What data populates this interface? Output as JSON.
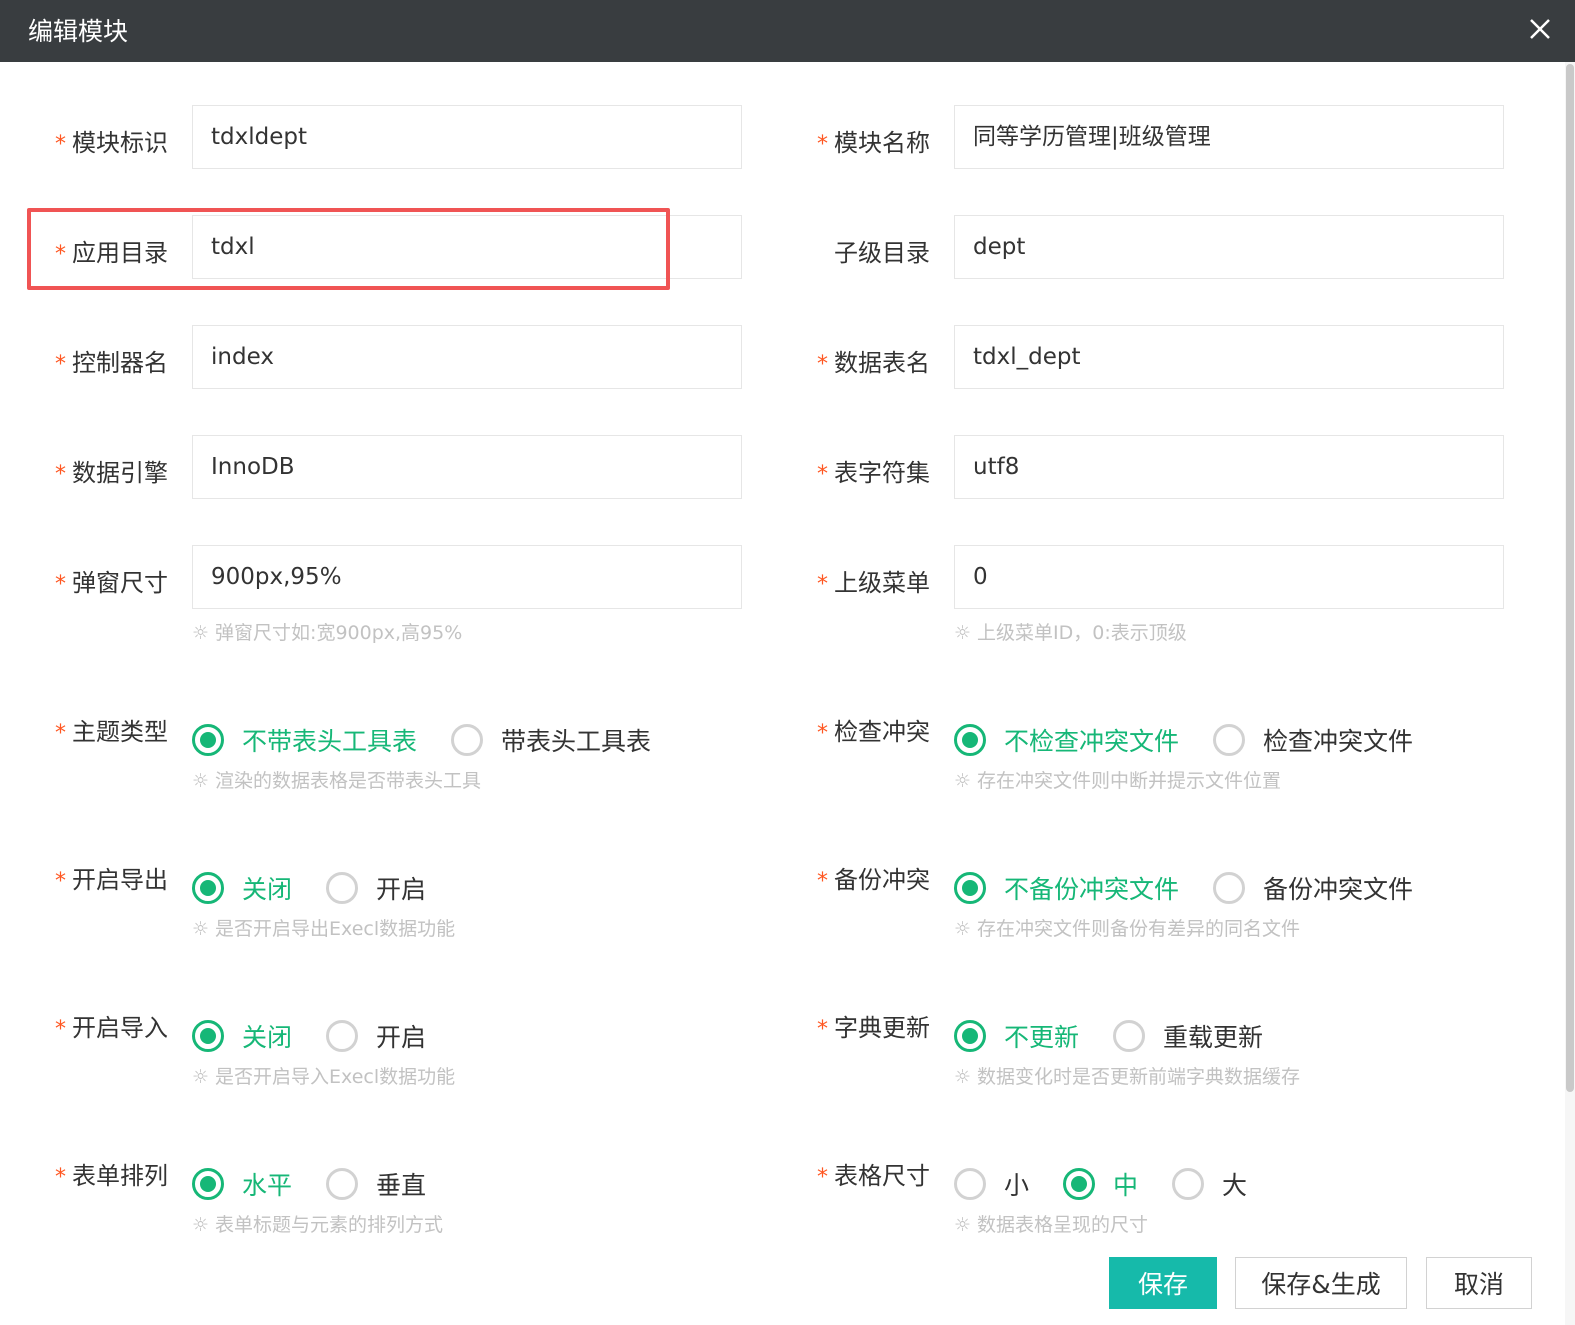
{
  "dialog": {
    "title": "编辑模块",
    "close_icon": "close-icon"
  },
  "fields": {
    "module_id": {
      "label": "模块标识",
      "value": "tdxldept",
      "required": true
    },
    "module_name": {
      "label": "模块名称",
      "value": "同等学历管理|班级管理",
      "required": true
    },
    "app_dir": {
      "label": "应用目录",
      "value": "tdxl",
      "required": true
    },
    "sub_dir": {
      "label": "子级目录",
      "value": "dept",
      "required": false
    },
    "controller": {
      "label": "控制器名",
      "value": "index",
      "required": true
    },
    "table_name": {
      "label": "数据表名",
      "value": "tdxl_dept",
      "required": true
    },
    "engine": {
      "label": "数据引擎",
      "value": "InnoDB",
      "required": true
    },
    "charset": {
      "label": "表字符集",
      "value": "utf8",
      "required": true
    },
    "popup_size": {
      "label": "弹窗尺寸",
      "value": "900px,95%",
      "required": true,
      "hint": "弹窗尺寸如:宽900px,高95%"
    },
    "parent_menu": {
      "label": "上级菜单",
      "value": "0",
      "required": true,
      "hint": "上级菜单ID，0:表示顶级"
    }
  },
  "radios": {
    "theme": {
      "label": "主题类型",
      "options": [
        "不带表头工具表",
        "带表头工具表"
      ],
      "selected": 0,
      "hint": "渲染的数据表格是否带表头工具"
    },
    "check_conflict": {
      "label": "检查冲突",
      "options": [
        "不检查冲突文件",
        "检查冲突文件"
      ],
      "selected": 0,
      "hint": "存在冲突文件则中断并提示文件位置"
    },
    "export": {
      "label": "开启导出",
      "options": [
        "关闭",
        "开启"
      ],
      "selected": 0,
      "hint": "是否开启导出Execl数据功能"
    },
    "backup_conflict": {
      "label": "备份冲突",
      "options": [
        "不备份冲突文件",
        "备份冲突文件"
      ],
      "selected": 0,
      "hint": "存在冲突文件则备份有差异的同名文件"
    },
    "import": {
      "label": "开启导入",
      "options": [
        "关闭",
        "开启"
      ],
      "selected": 0,
      "hint": "是否开启导入Execl数据功能"
    },
    "dict_update": {
      "label": "字典更新",
      "options": [
        "不更新",
        "重载更新"
      ],
      "selected": 0,
      "hint": "数据变化时是否更新前端字典数据缓存"
    },
    "form_layout": {
      "label": "表单排列",
      "options": [
        "水平",
        "垂直"
      ],
      "selected": 0,
      "hint": "表单标题与元素的排列方式"
    },
    "table_size": {
      "label": "表格尺寸",
      "options": [
        "小",
        "中",
        "大"
      ],
      "selected": 1,
      "hint": "数据表格呈现的尺寸"
    }
  },
  "buttons": {
    "save": "保存",
    "save_generate": "保存&生成",
    "cancel": "取消"
  },
  "required_mark": "*",
  "hint_icon": "sun-icon",
  "colors": {
    "accent": "#16b777",
    "primary_button": "#16baaa",
    "title_bar": "#393d40",
    "required": "#ff5722",
    "highlight": "#f05454"
  }
}
